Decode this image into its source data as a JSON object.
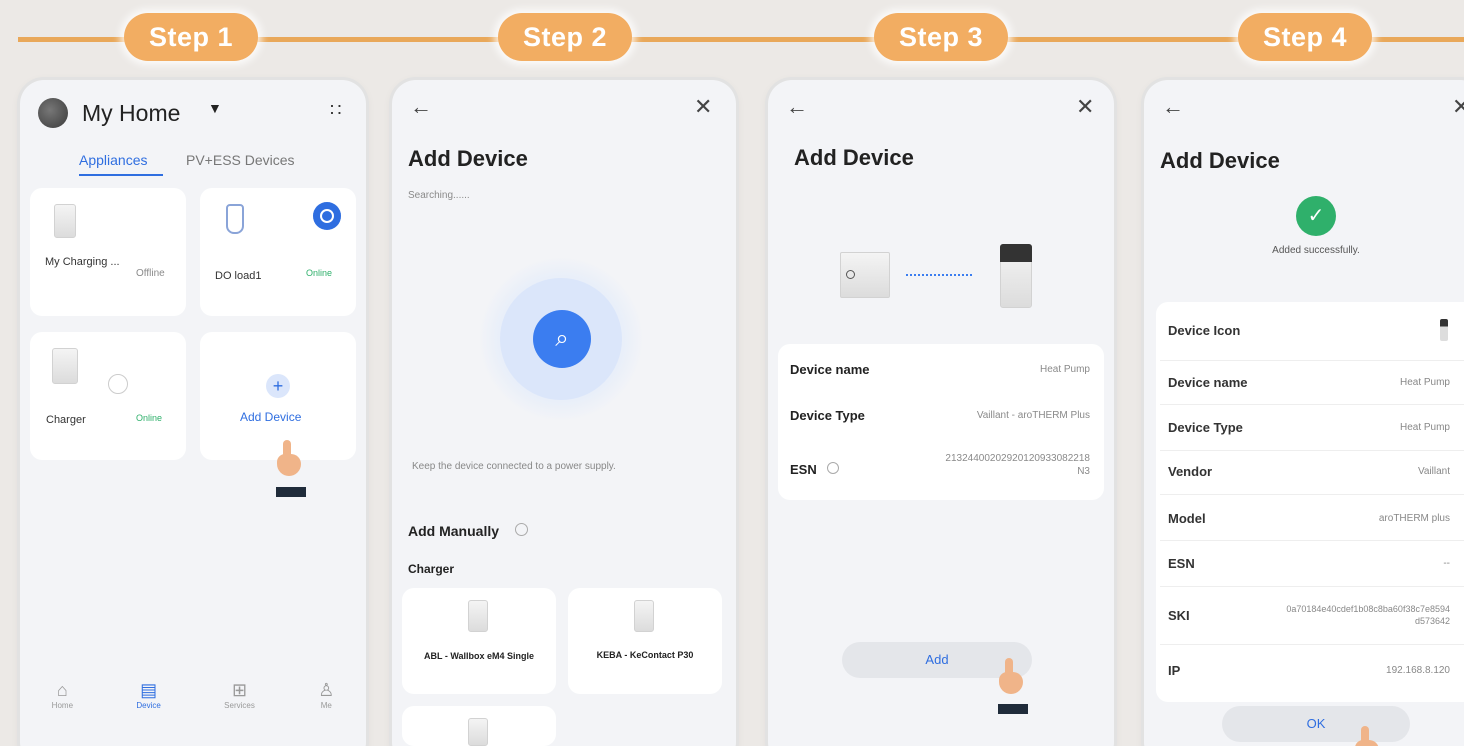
{
  "steps": [
    "Step 1",
    "Step 2",
    "Step 3",
    "Step 4"
  ],
  "colors": {
    "accent": "#f2ad62",
    "blue": "#3b82f6",
    "green": "#2fb06b"
  },
  "panel1": {
    "home_title": "My Home",
    "tabs": [
      "Appliances",
      "PV+ESS Devices"
    ],
    "devices": [
      {
        "name": "My Charging ...",
        "status": "Offline"
      },
      {
        "name": "DO load1",
        "status": "Online"
      },
      {
        "name": "Charger",
        "status": "Online"
      }
    ],
    "add_device": "Add Device",
    "nav": [
      "Home",
      "Device",
      "Services",
      "Me"
    ]
  },
  "panel2": {
    "title": "Add Device",
    "searching": "Searching......",
    "hint": "Keep the device connected to a power supply.",
    "add_manually": "Add Manually",
    "category": "Charger",
    "chargers": [
      "ABL - Wallbox eM4 Single",
      "KEBA - KeContact P30"
    ]
  },
  "panel3": {
    "title": "Add Device",
    "rows": [
      {
        "label": "Device name",
        "value": "Heat Pump"
      },
      {
        "label": "Device Type",
        "value": "Vaillant - aroTHERM Plus"
      },
      {
        "label": "ESN",
        "value": "21324400202920120933082218N3"
      }
    ],
    "add_button": "Add"
  },
  "panel4": {
    "title": "Add Device",
    "success": "Added successfully.",
    "rows": [
      {
        "label": "Device Icon",
        "value": ""
      },
      {
        "label": "Device name",
        "value": "Heat Pump"
      },
      {
        "label": "Device Type",
        "value": "Heat Pump"
      },
      {
        "label": "Vendor",
        "value": "Vaillant"
      },
      {
        "label": "Model",
        "value": "aroTHERM plus"
      },
      {
        "label": "ESN",
        "value": "--"
      },
      {
        "label": "SKI",
        "value": "0a70184e40cdef1b08c8ba60f38c7e8594d573642"
      },
      {
        "label": "IP",
        "value": "192.168.8.120"
      }
    ],
    "ok_button": "OK"
  }
}
